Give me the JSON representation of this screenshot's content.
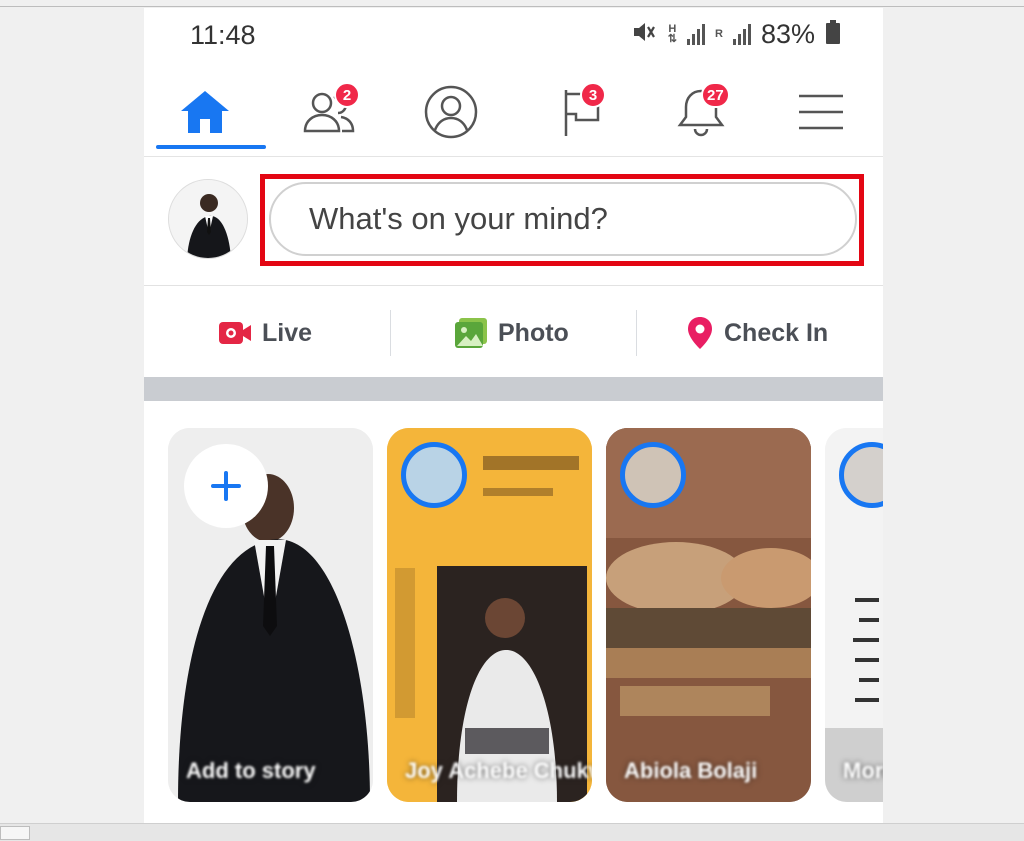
{
  "status_bar": {
    "time": "11:48",
    "net_h": "H",
    "net_r": "R",
    "battery": "83%"
  },
  "nav": {
    "items": [
      {
        "name": "home",
        "badge": ""
      },
      {
        "name": "friends",
        "badge": "2"
      },
      {
        "name": "profile",
        "badge": ""
      },
      {
        "name": "pages",
        "badge": "3"
      },
      {
        "name": "notifications",
        "badge": "27"
      },
      {
        "name": "menu",
        "badge": ""
      }
    ]
  },
  "composer": {
    "placeholder": "What's on your mind?"
  },
  "actions": {
    "live": "Live",
    "photo": "Photo",
    "check_in": "Check In"
  },
  "stories": [
    {
      "label": "Add to story"
    },
    {
      "label": "Joy Achebe Chukwuemeka"
    },
    {
      "label": "Abiola Bolaji"
    },
    {
      "label": "More"
    }
  ],
  "colors": {
    "accent": "#1877f2",
    "badge": "#f02849",
    "highlight": "#e30613"
  }
}
